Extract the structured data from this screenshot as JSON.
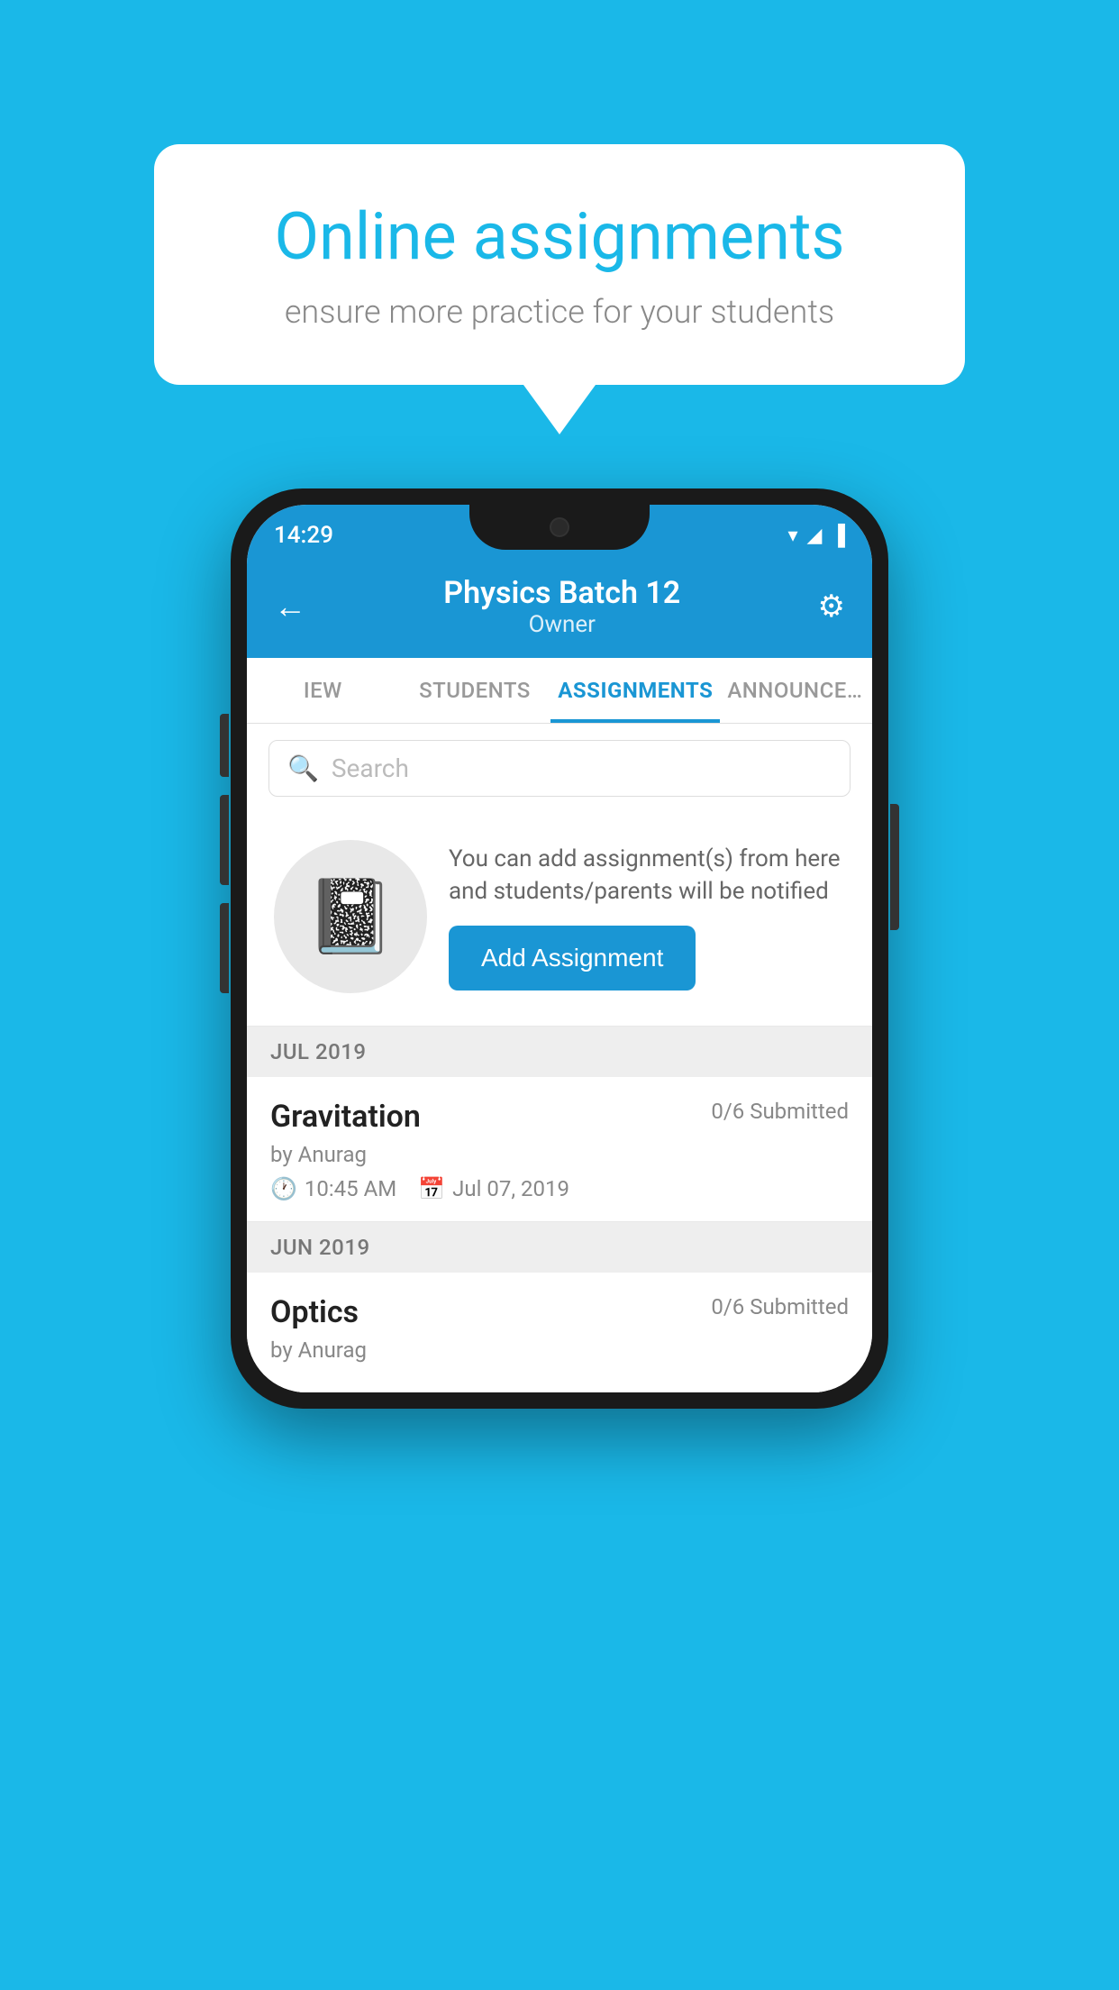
{
  "background_color": "#1ab8e8",
  "speech_bubble": {
    "title": "Online assignments",
    "subtitle": "ensure more practice for your students"
  },
  "status_bar": {
    "time": "14:29",
    "icons": [
      "▾",
      "▴",
      "▐"
    ]
  },
  "header": {
    "title": "Physics Batch 12",
    "subtitle": "Owner",
    "back_label": "←",
    "settings_label": "⚙"
  },
  "tabs": [
    {
      "label": "IEW",
      "active": false
    },
    {
      "label": "STUDENTS",
      "active": false
    },
    {
      "label": "ASSIGNMENTS",
      "active": true
    },
    {
      "label": "ANNOUNCEM…",
      "active": false
    }
  ],
  "search": {
    "placeholder": "Search"
  },
  "promo": {
    "text": "You can add assignment(s) from here and students/parents will be notified",
    "button_label": "Add Assignment"
  },
  "sections": [
    {
      "label": "JUL 2019",
      "assignments": [
        {
          "name": "Gravitation",
          "submitted": "0/6 Submitted",
          "by": "by Anurag",
          "time": "10:45 AM",
          "date": "Jul 07, 2019"
        }
      ]
    },
    {
      "label": "JUN 2019",
      "assignments": [
        {
          "name": "Optics",
          "submitted": "0/6 Submitted",
          "by": "by Anurag",
          "time": "",
          "date": ""
        }
      ]
    }
  ]
}
